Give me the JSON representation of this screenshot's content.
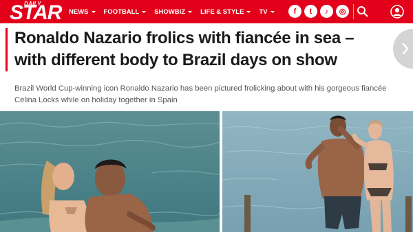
{
  "header": {
    "logo_top": "DAILY",
    "logo_main": "STAR",
    "nav": [
      {
        "label": "NEWS"
      },
      {
        "label": "FOOTBALL"
      },
      {
        "label": "SHOWBIZ"
      },
      {
        "label": "LIFE & STYLE"
      },
      {
        "label": "TV"
      }
    ],
    "social_icons": [
      "facebook-icon",
      "twitter-icon",
      "tiktok-icon",
      "instagram-icon"
    ],
    "social_glyphs": [
      "f",
      "t",
      "♪",
      "◎"
    ],
    "brand_color": "#e2001a"
  },
  "article": {
    "headline": "Ronaldo Nazario frolics with fiancée in sea – with different body to Brazil days on show",
    "standfirst": "Brazil World Cup-winning icon Ronaldo Nazario has been pictured frolicking about with his gorgeous fiancée Celina Locks while on holiday together in Spain"
  }
}
